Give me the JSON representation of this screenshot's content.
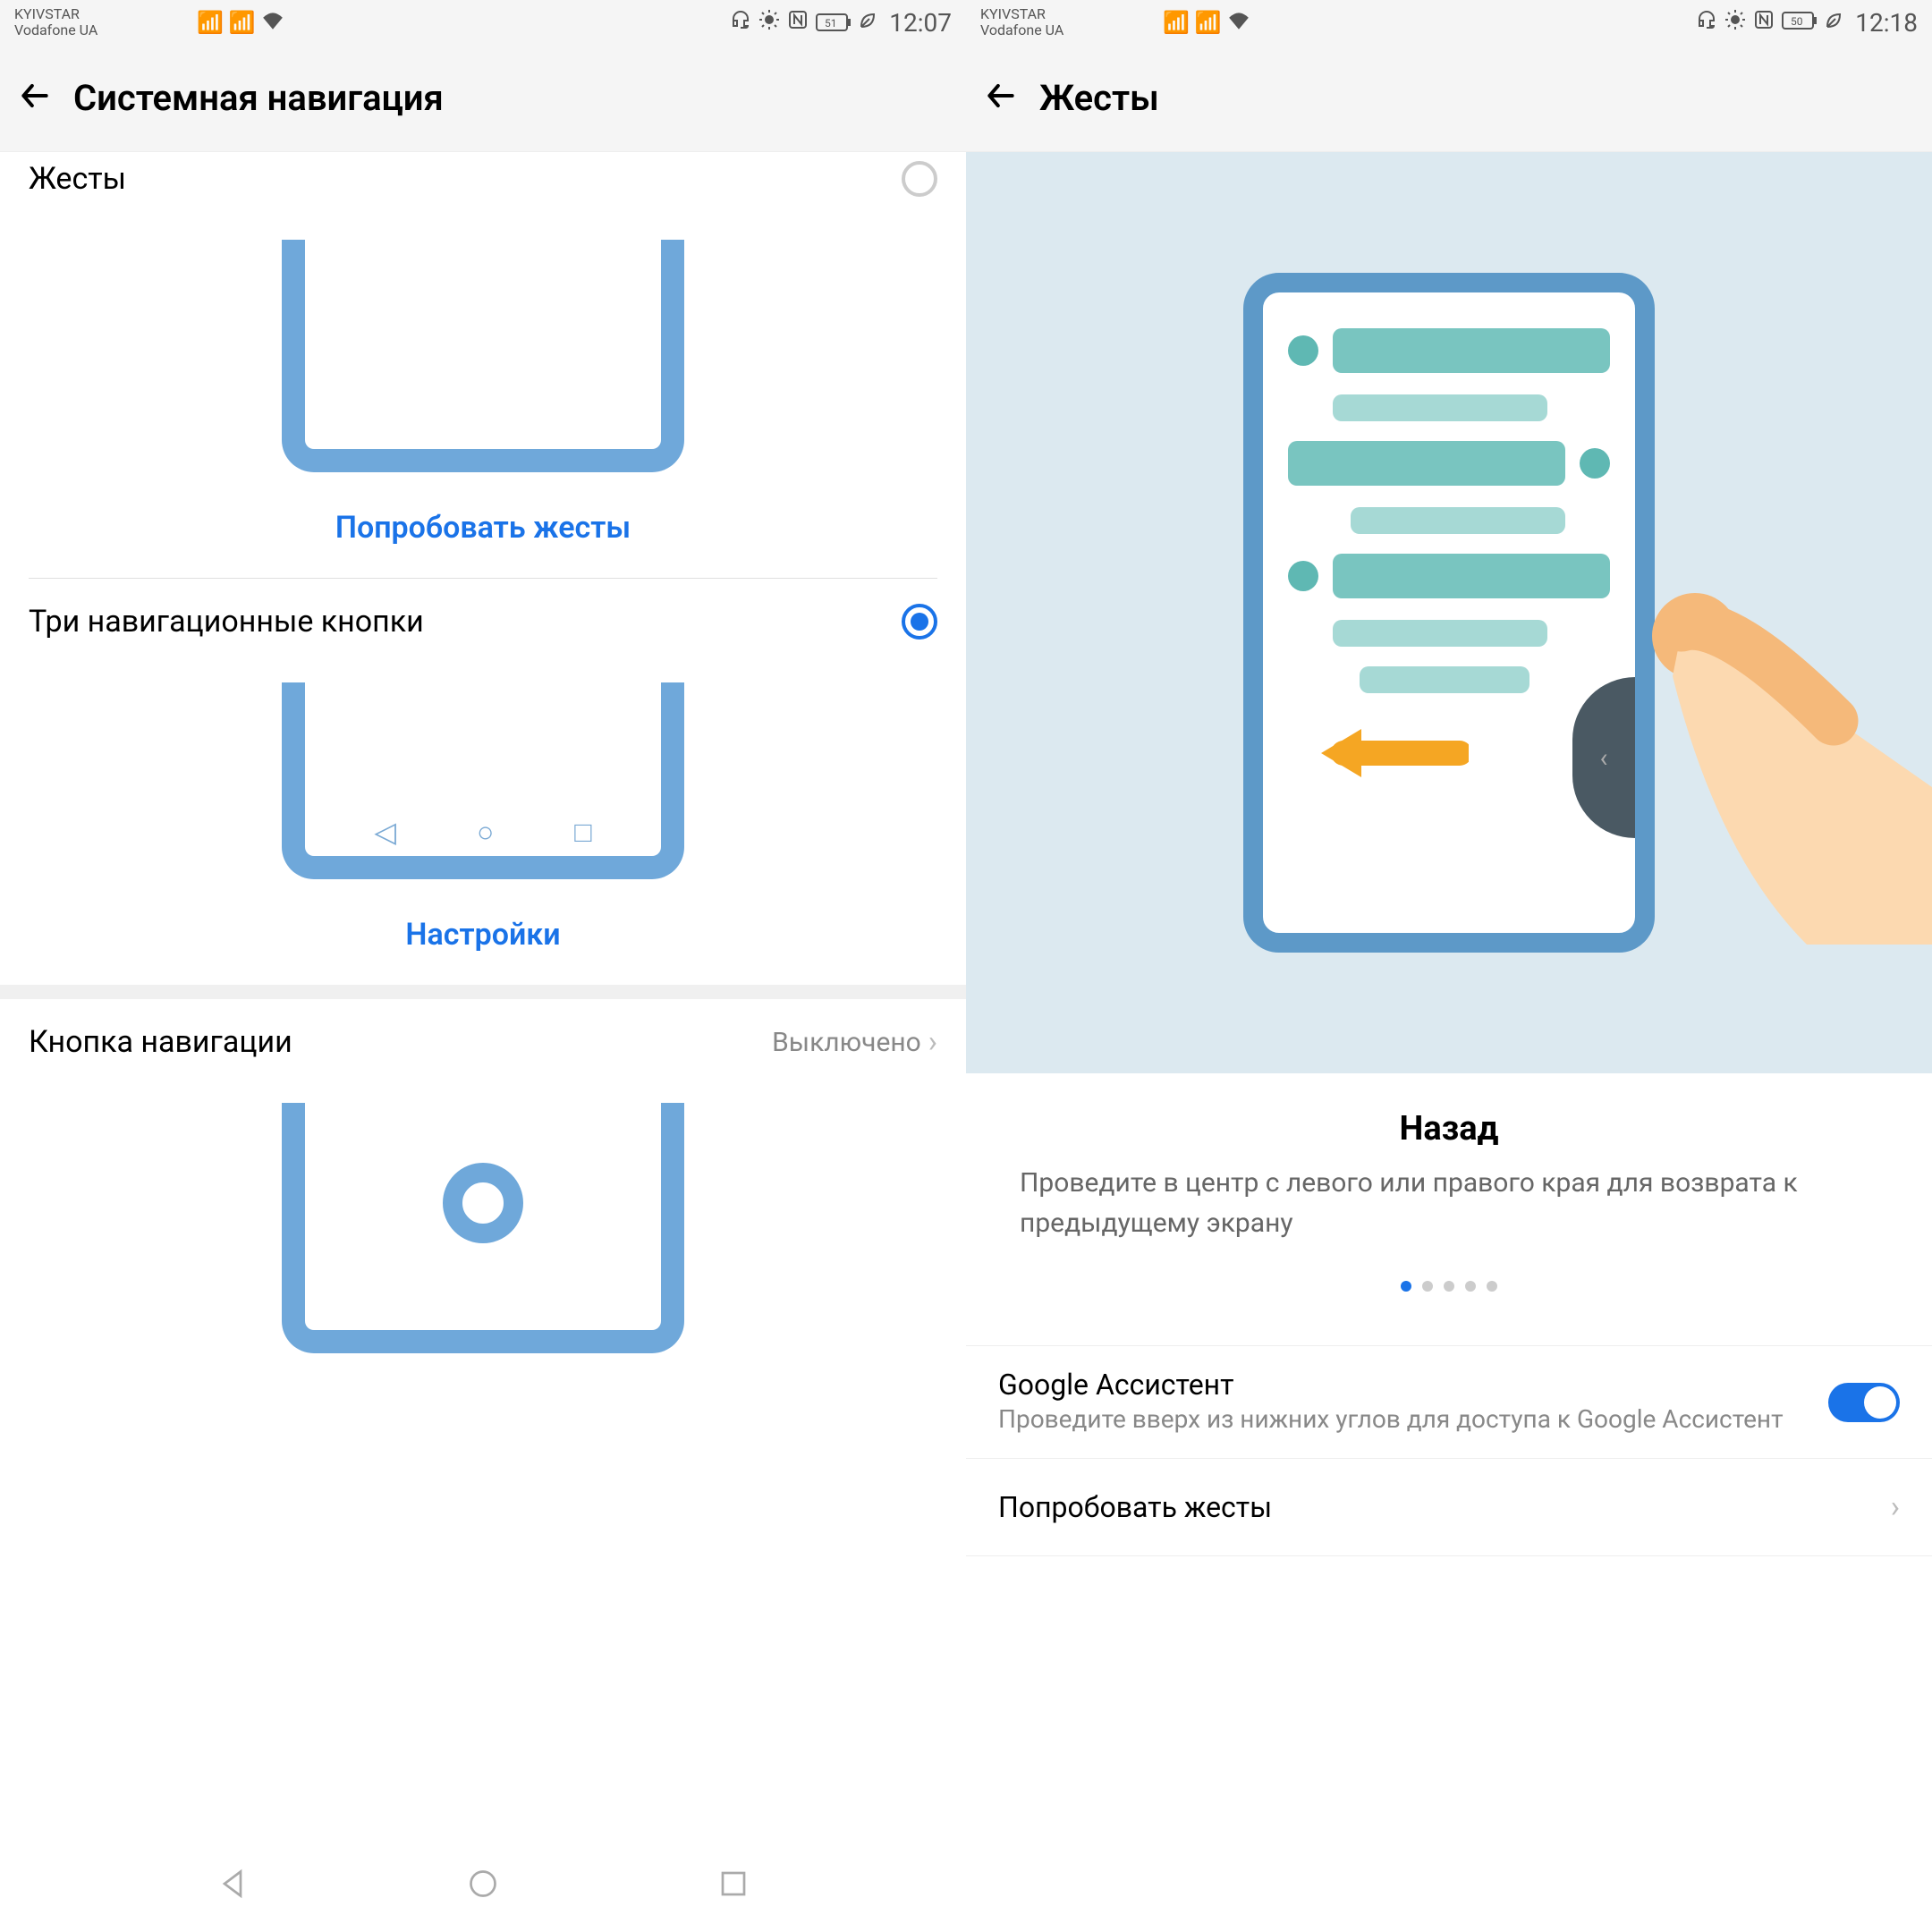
{
  "left": {
    "status": {
      "carrier1": "KYIVSTAR",
      "carrier2": "Vodafone UA",
      "time": "12:07",
      "battery": "51"
    },
    "app_title": "Системная навигация",
    "gestures_label": "Жесты",
    "gestures_link": "Попробовать жесты",
    "threebtn_label": "Три навигационные кнопки",
    "threebtn_link": "Настройки",
    "navbtn_label": "Кнопка навигации",
    "navbtn_value": "Выключено"
  },
  "right": {
    "status": {
      "carrier1": "KYIVSTAR",
      "carrier2": "Vodafone UA",
      "time": "12:18",
      "battery": "50"
    },
    "app_title": "Жесты",
    "desc_title": "Назад",
    "desc_text": "Проведите в центр с левого или правого края для возврата к предыдущему экрану",
    "assist_title": "Google Ассистент",
    "assist_sub": "Проведите вверх из нижних углов для доступа к Google Ассистент",
    "try_label": "Попробовать жесты"
  }
}
